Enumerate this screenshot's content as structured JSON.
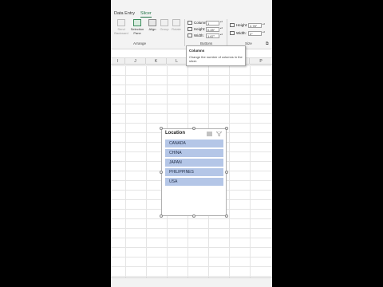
{
  "ribbon": {
    "tabs": [
      "Data Entry",
      "Slicer"
    ],
    "buttons": {
      "send_backward": "Send Backward",
      "selection_pane": "Selection Pane",
      "align": "Align",
      "group": "Group",
      "rotate": "Rotate"
    },
    "arrange_label": "Arrange",
    "buttons_group_label": "Buttons",
    "size_group_label": "Size",
    "columns": {
      "label": "Columns:",
      "value": "1"
    },
    "height": {
      "label": "Height:",
      "value": "0.28\""
    },
    "width": {
      "label": "Width:",
      "value": "1.67\""
    },
    "size_height": {
      "label": "Height:",
      "value": "2.78\""
    },
    "size_width": {
      "label": "Width:",
      "value": "2\""
    }
  },
  "tooltip": {
    "title": "Columns",
    "body": "Change the number of columns in the slicer."
  },
  "columns": [
    "I",
    "J",
    "K",
    "L",
    "M",
    "N",
    "O",
    "P"
  ],
  "slicer": {
    "header": "Location",
    "items": [
      "CANADA",
      "CHINA",
      "JAPAN",
      "PHILIPPINES",
      "USA"
    ],
    "item_color": "#b4c6e7"
  },
  "colors": {
    "accent": "#1f7244",
    "background": "#000000"
  }
}
